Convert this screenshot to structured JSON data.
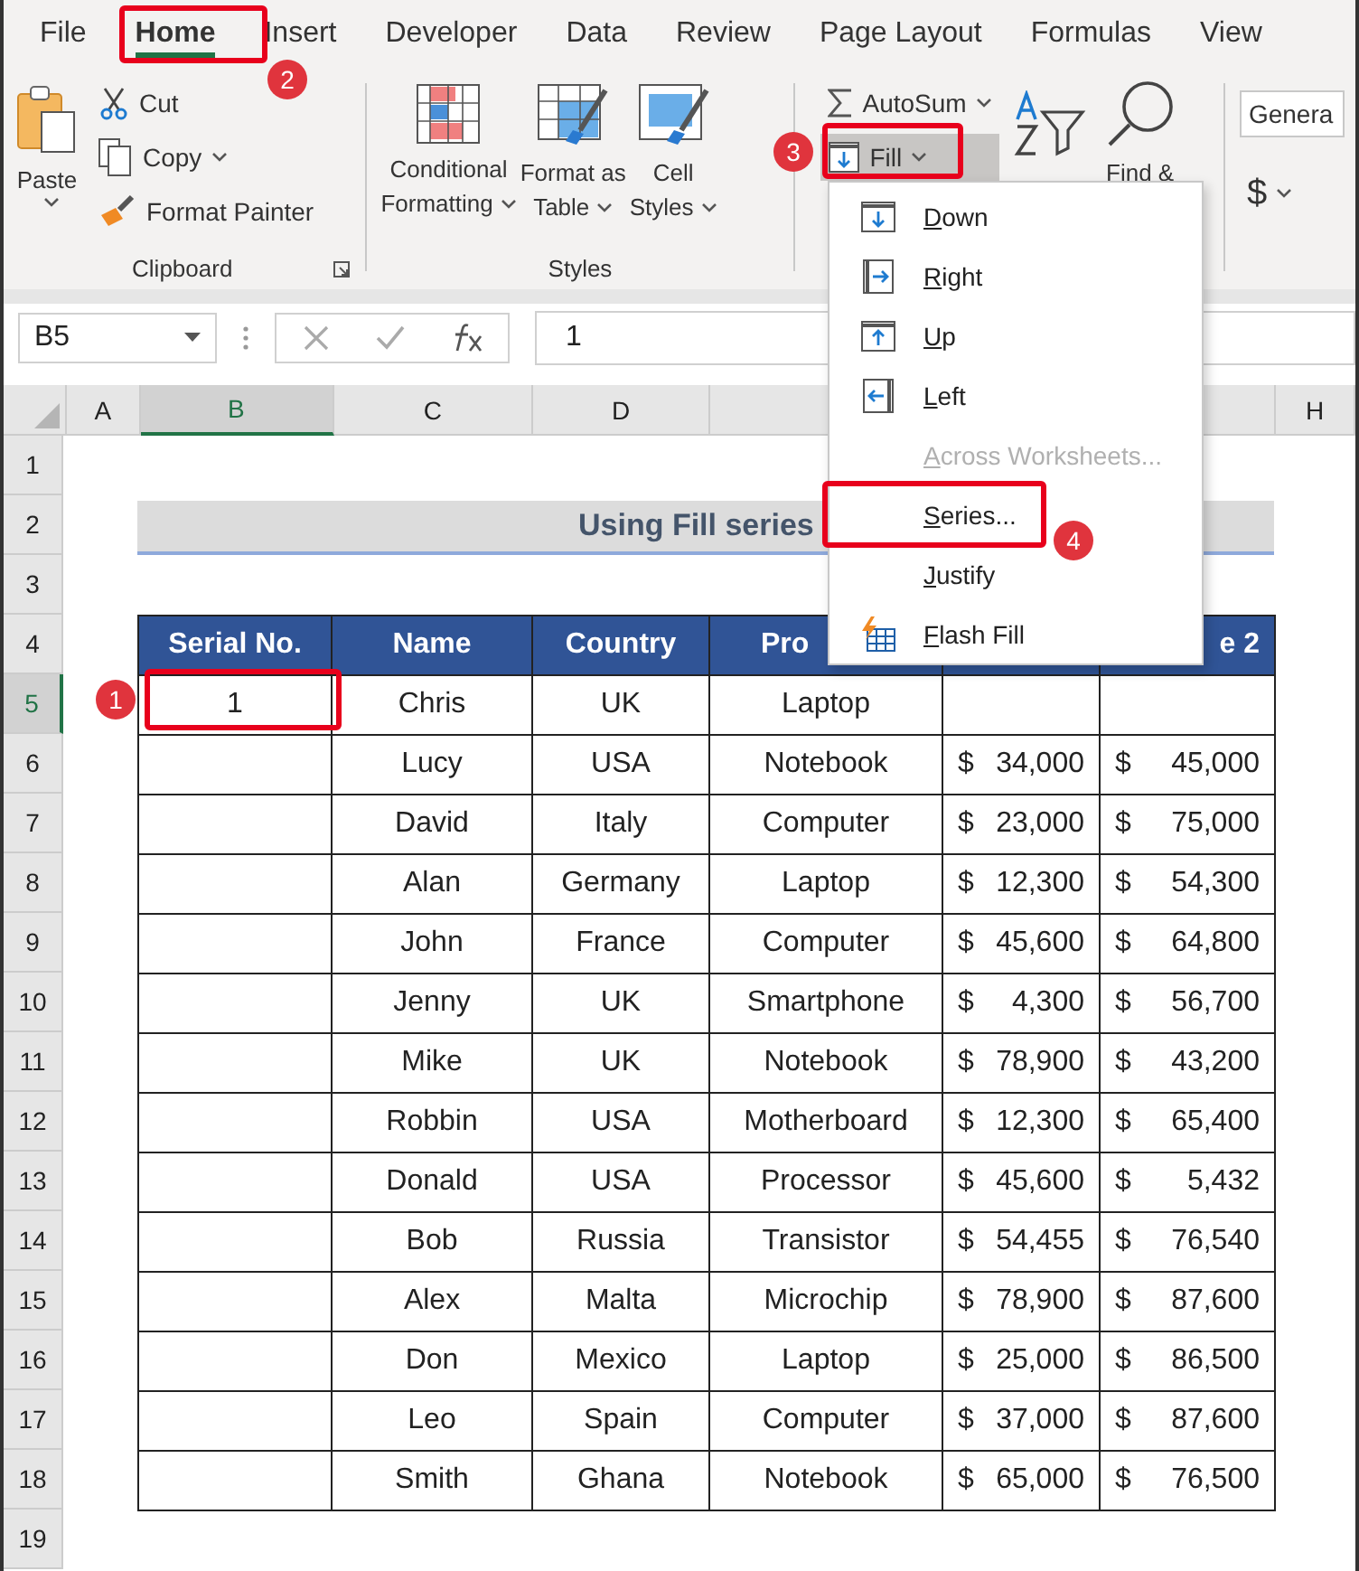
{
  "ribbon_tabs": [
    {
      "label": "File",
      "selected": false
    },
    {
      "label": "Home",
      "selected": true
    },
    {
      "label": "Insert",
      "selected": false
    },
    {
      "label": "Developer",
      "selected": false
    },
    {
      "label": "Data",
      "selected": false
    },
    {
      "label": "Review",
      "selected": false
    },
    {
      "label": "Page Layout",
      "selected": false
    },
    {
      "label": "Formulas",
      "selected": false
    },
    {
      "label": "View",
      "selected": false
    }
  ],
  "clipboard": {
    "paste": "Paste",
    "cut": "Cut",
    "copy": "Copy",
    "format_painter": "Format Painter",
    "group_label": "Clipboard"
  },
  "styles": {
    "conditional": [
      "Conditional",
      "Formatting"
    ],
    "format_table": [
      "Format as",
      "Table"
    ],
    "cell_styles": [
      "Cell",
      "Styles"
    ],
    "group_label": "Styles"
  },
  "editing": {
    "autosum": "AutoSum",
    "fill": {
      "label": "Fill",
      "pressed": true
    },
    "find": "Find &"
  },
  "number": {
    "format": "Genera",
    "currency": "$"
  },
  "formula_bar": {
    "name_box": "B5",
    "value": "1"
  },
  "fill_menu": [
    {
      "label": "Down",
      "disabled": false
    },
    {
      "label": "Right",
      "disabled": false
    },
    {
      "label": "Up",
      "disabled": false
    },
    {
      "label": "Left",
      "disabled": false
    },
    {
      "label": "Across Worksheets...",
      "disabled": true
    },
    {
      "label": "Series...",
      "disabled": false
    },
    {
      "label": "Justify",
      "disabled": false
    },
    {
      "label": "Flash Fill",
      "disabled": false
    }
  ],
  "column_headers": [
    {
      "label": "A",
      "selected": false
    },
    {
      "label": "B",
      "selected": true
    },
    {
      "label": "C",
      "selected": false
    },
    {
      "label": "D",
      "selected": false
    },
    {
      "label": "H",
      "selected": false
    }
  ],
  "row_headers": [
    {
      "label": "1",
      "selected": false
    },
    {
      "label": "2",
      "selected": false
    },
    {
      "label": "3",
      "selected": false
    },
    {
      "label": "4",
      "selected": false
    },
    {
      "label": "5",
      "selected": true
    },
    {
      "label": "6",
      "selected": false
    },
    {
      "label": "7",
      "selected": false
    },
    {
      "label": "8",
      "selected": false
    },
    {
      "label": "9",
      "selected": false
    },
    {
      "label": "10",
      "selected": false
    },
    {
      "label": "11",
      "selected": false
    },
    {
      "label": "12",
      "selected": false
    },
    {
      "label": "13",
      "selected": false
    },
    {
      "label": "14",
      "selected": false
    },
    {
      "label": "15",
      "selected": false
    },
    {
      "label": "16",
      "selected": false
    },
    {
      "label": "17",
      "selected": false
    },
    {
      "label": "18",
      "selected": false
    },
    {
      "label": "19",
      "selected": false
    }
  ],
  "sheet_title": "Using Fill series",
  "table": {
    "columns": [
      {
        "label": "Serial No."
      },
      {
        "label": "Name"
      },
      {
        "label": "Country"
      },
      {
        "label": "Pro"
      },
      {},
      {
        "label": "e 2"
      }
    ],
    "rows": [
      {
        "serial": "1",
        "name": "Chris",
        "country": "UK",
        "product": "Laptop"
      },
      {
        "name": "Lucy",
        "country": "USA",
        "product": "Notebook",
        "column_5": {
          "currency": "$",
          "amount": "34,000"
        },
        "column_6": {
          "currency": "$",
          "amount": "45,000"
        }
      },
      {
        "name": "David",
        "country": "Italy",
        "product": "Computer",
        "column_5": {
          "currency": "$",
          "amount": "23,000"
        },
        "column_6": {
          "currency": "$",
          "amount": "75,000"
        }
      },
      {
        "name": "Alan",
        "country": "Germany",
        "product": "Laptop",
        "column_5": {
          "currency": "$",
          "amount": "12,300"
        },
        "column_6": {
          "currency": "$",
          "amount": "54,300"
        }
      },
      {
        "name": "John",
        "country": "France",
        "product": "Computer",
        "column_5": {
          "currency": "$",
          "amount": "45,600"
        },
        "column_6": {
          "currency": "$",
          "amount": "64,800"
        }
      },
      {
        "name": "Jenny",
        "country": "UK",
        "product": "Smartphone",
        "column_5": {
          "currency": "$",
          "amount": "4,300"
        },
        "column_6": {
          "currency": "$",
          "amount": "56,700"
        }
      },
      {
        "name": "Mike",
        "country": "UK",
        "product": "Notebook",
        "column_5": {
          "currency": "$",
          "amount": "78,900"
        },
        "column_6": {
          "currency": "$",
          "amount": "43,200"
        }
      },
      {
        "name": "Robbin",
        "country": "USA",
        "product": "Motherboard",
        "column_5": {
          "currency": "$",
          "amount": "12,300"
        },
        "column_6": {
          "currency": "$",
          "amount": "65,400"
        }
      },
      {
        "name": "Donald",
        "country": "USA",
        "product": "Processor",
        "column_5": {
          "currency": "$",
          "amount": "45,600"
        },
        "column_6": {
          "currency": "$",
          "amount": "5,432"
        }
      },
      {
        "name": "Bob",
        "country": "Russia",
        "product": "Transistor",
        "column_5": {
          "currency": "$",
          "amount": "54,455"
        },
        "column_6": {
          "currency": "$",
          "amount": "76,540"
        }
      },
      {
        "name": "Alex",
        "country": "Malta",
        "product": "Microchip",
        "column_5": {
          "currency": "$",
          "amount": "78,900"
        },
        "column_6": {
          "currency": "$",
          "amount": "87,600"
        }
      },
      {
        "name": "Don",
        "country": "Mexico",
        "product": "Laptop",
        "column_5": {
          "currency": "$",
          "amount": "25,000"
        },
        "column_6": {
          "currency": "$",
          "amount": "86,500"
        }
      },
      {
        "name": "Leo",
        "country": "Spain",
        "product": "Computer",
        "column_5": {
          "currency": "$",
          "amount": "37,000"
        },
        "column_6": {
          "currency": "$",
          "amount": "87,600"
        }
      },
      {
        "name": "Smith",
        "country": "Ghana",
        "product": "Notebook",
        "column_5": {
          "currency": "$",
          "amount": "65,000"
        },
        "column_6": {
          "currency": "$",
          "amount": "76,500"
        }
      }
    ]
  },
  "step_badges": [
    "1",
    "2",
    "3",
    "4"
  ]
}
